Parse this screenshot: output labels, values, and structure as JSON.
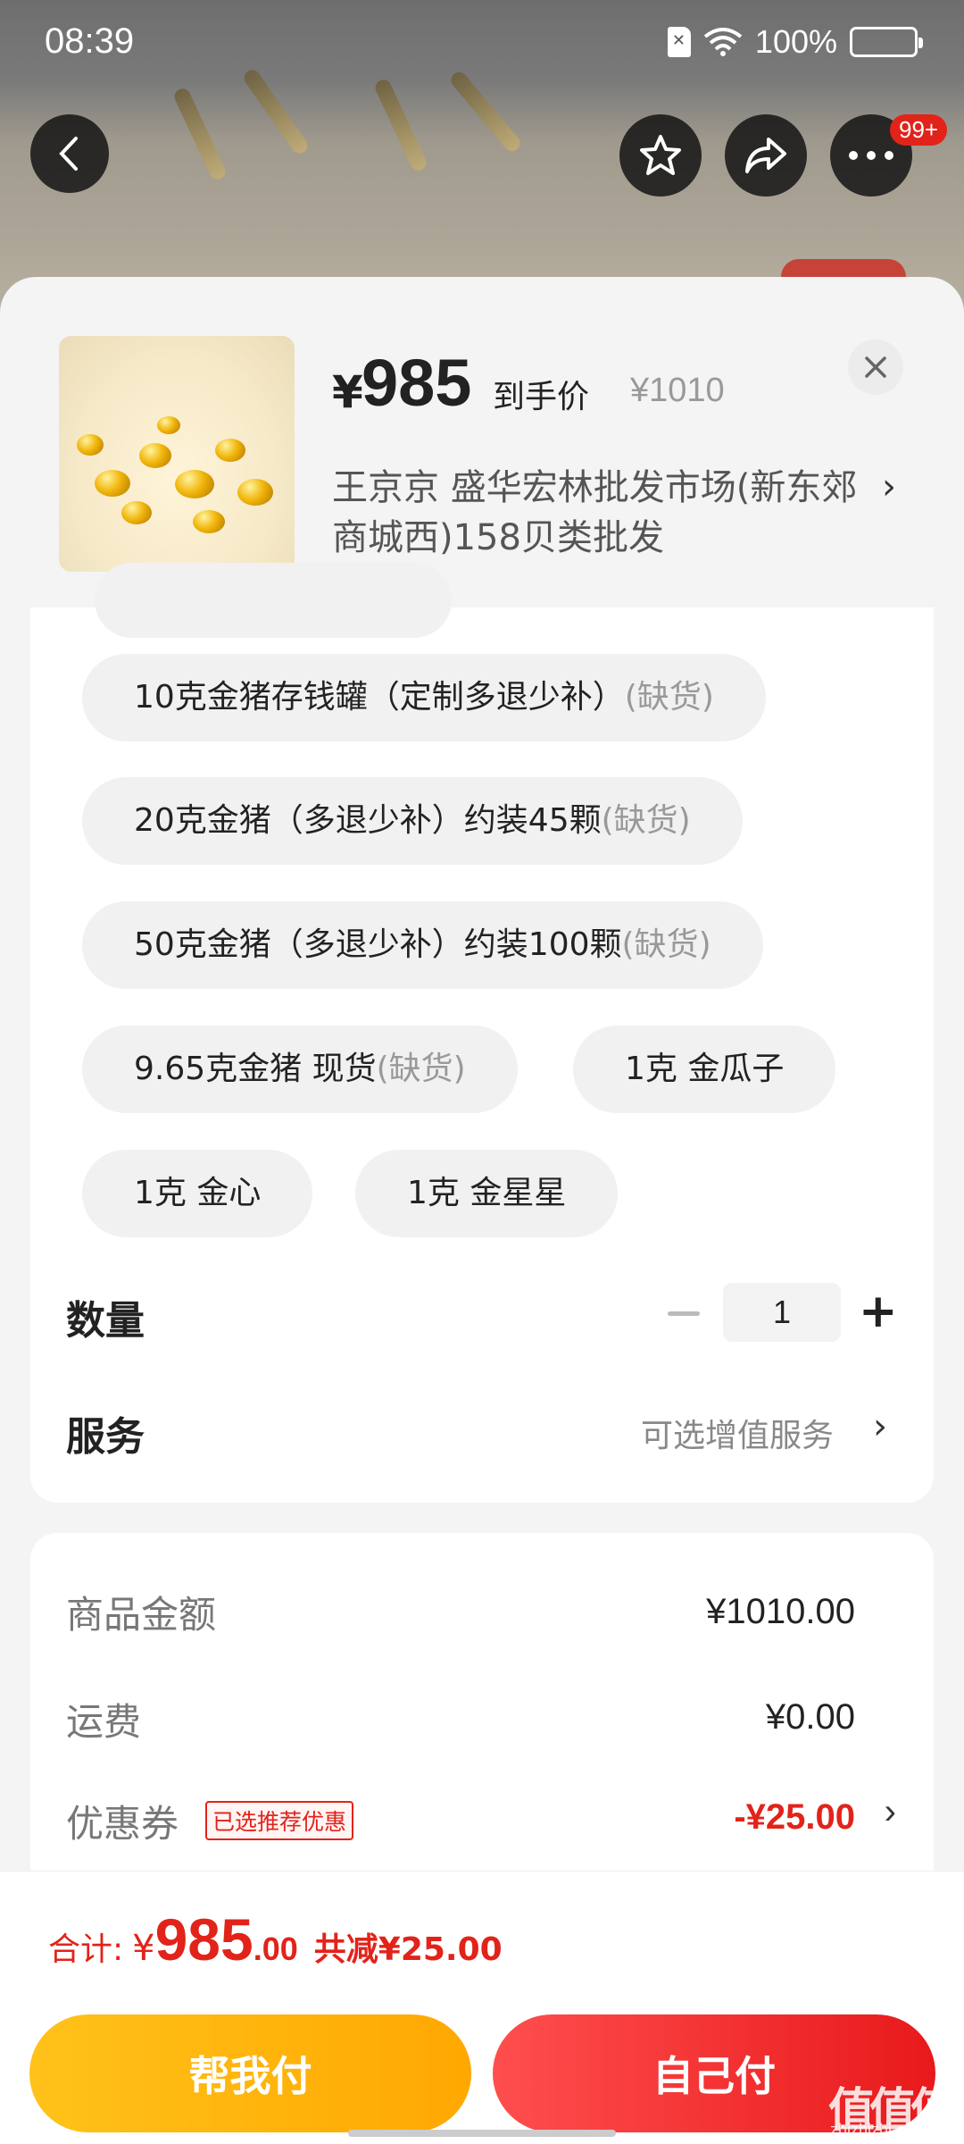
{
  "status_bar": {
    "time": "08:39",
    "battery": "100%"
  },
  "top_actions": {
    "badge": "99+"
  },
  "product": {
    "price_symbol": "¥",
    "price": "985",
    "price_tag": "到手价",
    "original_price": "¥1010",
    "shop_name": "王京京  盛华宏林批发市场(新东郊商城西)158贝类批发",
    "shop_arrow": "›"
  },
  "options": [
    {
      "label": "10克金猪存钱罐（定制多退少补）",
      "stock": "(缺货)"
    },
    {
      "label": "20克金猪（多退少补）约装45颗",
      "stock": "(缺货)"
    },
    {
      "label": "50克金猪（多退少补）约装100颗",
      "stock": "(缺货)"
    },
    {
      "label": "9.65克金猪 现货",
      "stock": "(缺货)"
    },
    {
      "label": "1克 金瓜子",
      "stock": ""
    },
    {
      "label": "1克 金心",
      "stock": ""
    },
    {
      "label": "1克 金星星",
      "stock": ""
    }
  ],
  "quantity": {
    "label": "数量",
    "value": "1"
  },
  "service": {
    "label": "服务",
    "value": "可选增值服务",
    "arrow": "›"
  },
  "summary": {
    "goods_label": "商品金额",
    "goods_value": "¥1010.00",
    "shipping_label": "运费",
    "shipping_value": "¥0.00",
    "coupon_label": "优惠券",
    "coupon_tag": "已选推荐优惠",
    "coupon_value": "-¥25.00",
    "coupon_arrow": "›"
  },
  "total": {
    "label": "合计:",
    "symbol": "¥",
    "integer": "985",
    "decimal": ".00",
    "saved": "共减¥25.00"
  },
  "buttons": {
    "help_pay": "帮我付",
    "self_pay": "自己付"
  },
  "watermark": {
    "text": "值值值",
    "sub": "zhizhizhi.com"
  },
  "colors": {
    "accent_red": "#e2231a",
    "help_pay": "#ffb400",
    "self_pay": "#f0282a"
  }
}
